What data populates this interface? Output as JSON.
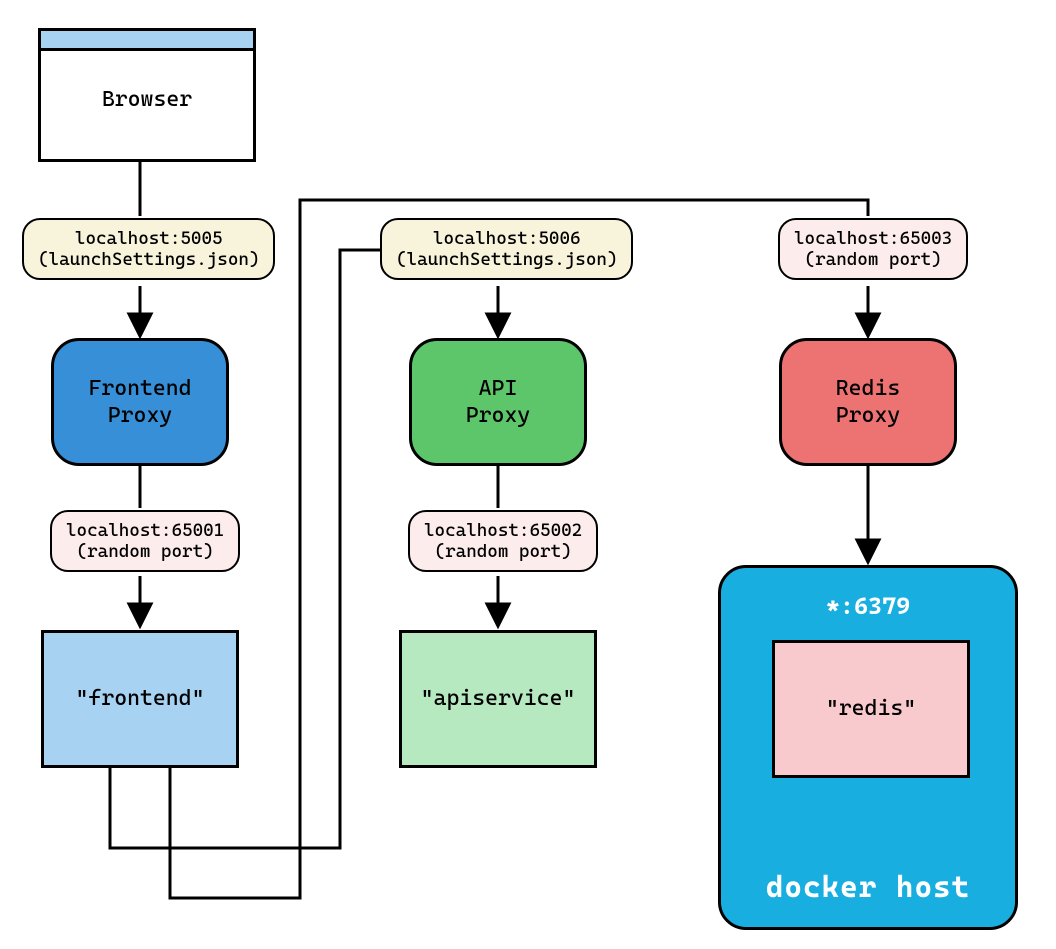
{
  "browser": {
    "label": "Browser"
  },
  "edge_labels": {
    "frontend_in": {
      "line1": "localhost:5005",
      "line2": "(launchSettings.json)"
    },
    "api_in": {
      "line1": "localhost:5006",
      "line2": "(launchSettings.json)"
    },
    "redis_in": {
      "line1": "localhost:65003",
      "line2": "(random port)"
    },
    "frontend_out": {
      "line1": "localhost:65001",
      "line2": "(random port)"
    },
    "api_out": {
      "line1": "localhost:65002",
      "line2": "(random port)"
    }
  },
  "proxies": {
    "frontend": {
      "line1": "Frontend",
      "line2": "Proxy"
    },
    "api": {
      "line1": "API",
      "line2": "Proxy"
    },
    "redis": {
      "line1": "Redis",
      "line2": "Proxy"
    }
  },
  "services": {
    "frontend": "\"frontend\"",
    "apiservice": "\"apiservice\"",
    "redis": "\"redis\""
  },
  "docker": {
    "port": "*:6379",
    "label": "docker host"
  }
}
